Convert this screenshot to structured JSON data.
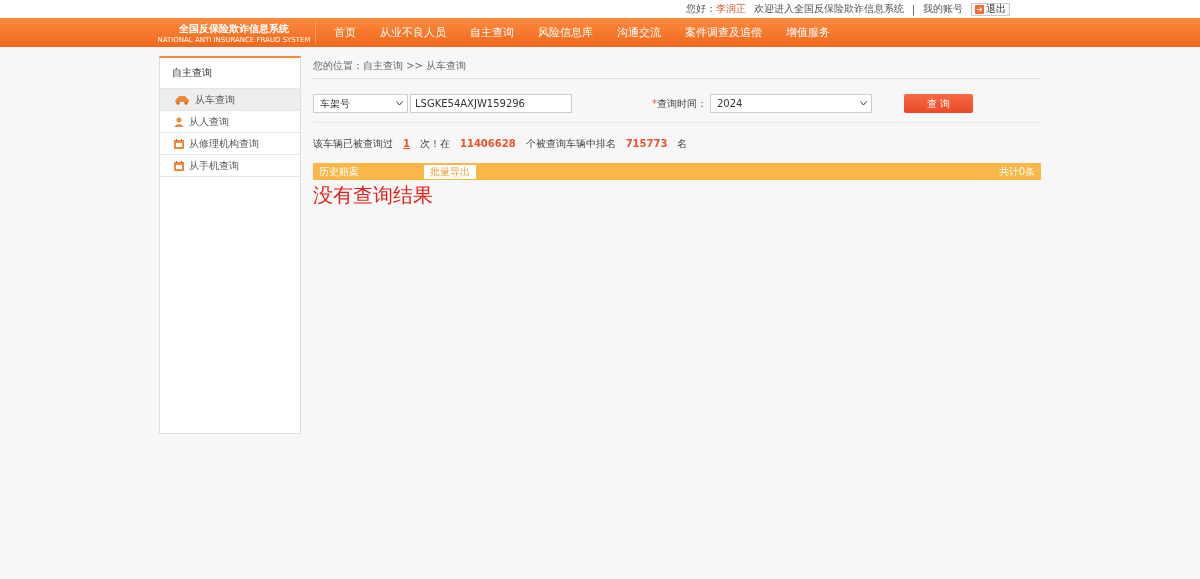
{
  "top_bar": {
    "greeting": "您好：",
    "user_name": "李润正",
    "welcome": "欢迎进入全国反保险欺诈信息系统",
    "separator": "|",
    "account_link": "我的账号",
    "logout_button": "退出"
  },
  "logo": {
    "title": "全国反保险欺诈信息系统",
    "subtitle": "NATIONAL ANTI INSURANCE FRAUD SYSTEM"
  },
  "nav": [
    {
      "label": "首页",
      "selected": false
    },
    {
      "label": "从业不良人员",
      "selected": false
    },
    {
      "label": "自主查询",
      "selected": false
    },
    {
      "label": "风险信息库",
      "selected": false
    },
    {
      "label": "沟通交流",
      "selected": false
    },
    {
      "label": "案件调查及追偿",
      "selected": false
    },
    {
      "label": "增值服务",
      "selected": false
    }
  ],
  "sidebar": {
    "title": "自主查询",
    "items": [
      {
        "label": "从车查询",
        "kind": "car",
        "selected": true
      },
      {
        "label": "从人查询",
        "kind": "person",
        "selected": false
      },
      {
        "label": "从修理机构查询",
        "kind": "calendar",
        "selected": false
      },
      {
        "label": "从手机查询",
        "kind": "calendar",
        "selected": false
      }
    ]
  },
  "breadcrumb": "您的位置：自主查询 >> 从车查询",
  "search": {
    "type_select": "车架号",
    "vin_value": "LSGKE54AXJW159296",
    "required_mark": "*",
    "time_label": "查询时间：",
    "time_select": "2024",
    "query_button": "查 询"
  },
  "stats": {
    "prefix": "该车辆已被查询过",
    "count": "1",
    "middle": "次！在",
    "total": "11406628",
    "middle2": "个被查询车辆中排名",
    "rank": "715773",
    "suffix": "名"
  },
  "results_bar": {
    "title": "历史赔案",
    "export_button": "批量导出",
    "total": "共计0条"
  },
  "no_result": "没有查询结果"
}
